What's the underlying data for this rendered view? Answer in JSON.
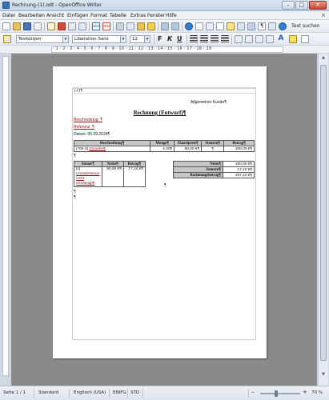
{
  "window": {
    "title": "Rechnung-(1).odt - OpenOffice Writer"
  },
  "menu": [
    "Datei",
    "Bearbeiten",
    "Ansicht",
    "Einfügen",
    "Format",
    "Tabelle",
    "Extras",
    "Fenster",
    "Hilfe"
  ],
  "toolbar": {
    "style": "Textkörper",
    "font": "Liberation Sans",
    "size": "12",
    "bold": "F",
    "italic": "K",
    "underline": "U",
    "find_label": "Text suchen"
  },
  "ruler_numbers": "· 1 · 2 · 3 · 4 · 5 · 6 · 7 · 8 · 9 · 10 · 11 · 12 · 13 · 14 · 15 · 16 · 17 · 18 · 19 ·",
  "document": {
    "header_text": "[2]¶",
    "customer": "Allgemeiner Kunde¶",
    "title": "Rechnung (Entwurf)¶",
    "beschreibung": "Beschreibung: ¶",
    "referenz": "Referenz: ¶",
    "datum": "Datum: 05.09.2024¶",
    "items": {
      "headers": [
        "Beschreibung¶",
        "Menge¶",
        "Einzelpreis¶",
        "Steuern¶",
        "Betrag¶"
      ],
      "rows": [
        {
          "desc_prefix": "[700-3] ",
          "desc_link": "Stunden¶",
          "menge": "2,00¶",
          "einzelpreis": "90,00 €¶",
          "steuern": "¶",
          "betrag": "180,00 €¶"
        }
      ]
    },
    "after_items_mark": "¶",
    "taxes": {
      "headers": [
        "Steuer¶",
        "Netto¶",
        "Betrag¶"
      ],
      "row": {
        "steuer_prefix": "[1] ",
        "steuer_link": "Umsatzsteuer nicht ermässigt¶",
        "netto": "90,00 €¶",
        "betrag": "17,10 €¶"
      }
    },
    "middle_mark": "¶",
    "totals": [
      {
        "label": "Netto¶",
        "value": "180,00 €¶"
      },
      {
        "label": "Steuern¶",
        "value": "17,10 €¶"
      },
      {
        "label": "Rechnungsbetrag¶",
        "value": "197,10 €¶"
      }
    ],
    "trailing_marks": [
      "¶",
      "¶"
    ]
  },
  "status": {
    "page": "Seite 1 / 1",
    "style": "Standard",
    "language": "Englisch (USA)",
    "insert": "EINFG",
    "selection": "STD",
    "zoom": "70 %"
  }
}
